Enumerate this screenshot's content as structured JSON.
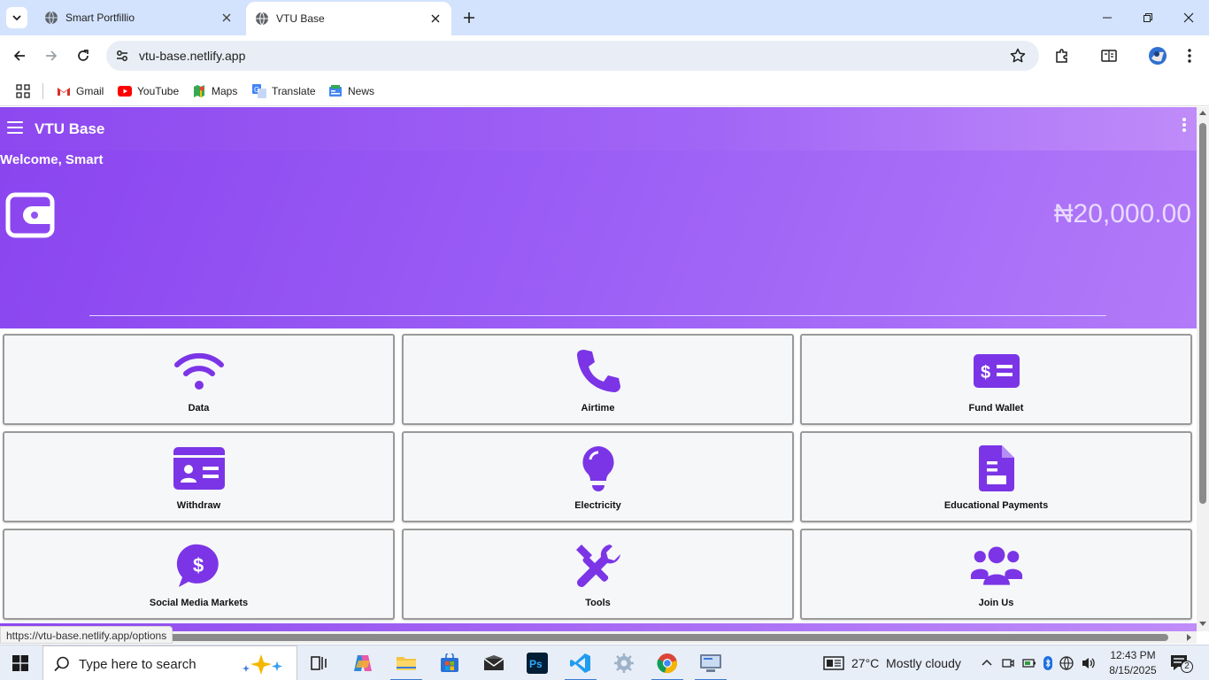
{
  "browser": {
    "tabs": [
      {
        "title": "Smart Portfillio",
        "active": false
      },
      {
        "title": "VTU Base",
        "active": true
      }
    ],
    "url": "vtu-base.netlify.app",
    "bookmarks": [
      {
        "label": "Gmail",
        "icon": "gmail-icon"
      },
      {
        "label": "YouTube",
        "icon": "youtube-icon"
      },
      {
        "label": "Maps",
        "icon": "maps-icon"
      },
      {
        "label": "Translate",
        "icon": "translate-icon"
      },
      {
        "label": "News",
        "icon": "news-icon"
      }
    ],
    "status_url": "https://vtu-base.netlify.app/options"
  },
  "app": {
    "title": "VTU Base",
    "welcome": "Welcome, Smart",
    "balance": "₦20,000.00",
    "accent_color": "#7b35e6",
    "services": [
      {
        "label": "Data",
        "icon": "wifi-icon"
      },
      {
        "label": "Airtime",
        "icon": "phone-icon"
      },
      {
        "label": "Fund Wallet",
        "icon": "money-bill-icon"
      },
      {
        "label": "Withdraw",
        "icon": "id-card-icon"
      },
      {
        "label": "Electricity",
        "icon": "lightbulb-icon"
      },
      {
        "label": "Educational Payments",
        "icon": "document-icon"
      },
      {
        "label": "Social Media Markets",
        "icon": "dollar-chat-icon"
      },
      {
        "label": "Tools",
        "icon": "tools-icon"
      },
      {
        "label": "Join Us",
        "icon": "users-icon"
      }
    ]
  },
  "taskbar": {
    "search_placeholder": "Type here to search",
    "weather": "27°C  Mostly cloudy",
    "time": "12:43 PM",
    "date": "8/15/2025",
    "notifications": "2"
  }
}
